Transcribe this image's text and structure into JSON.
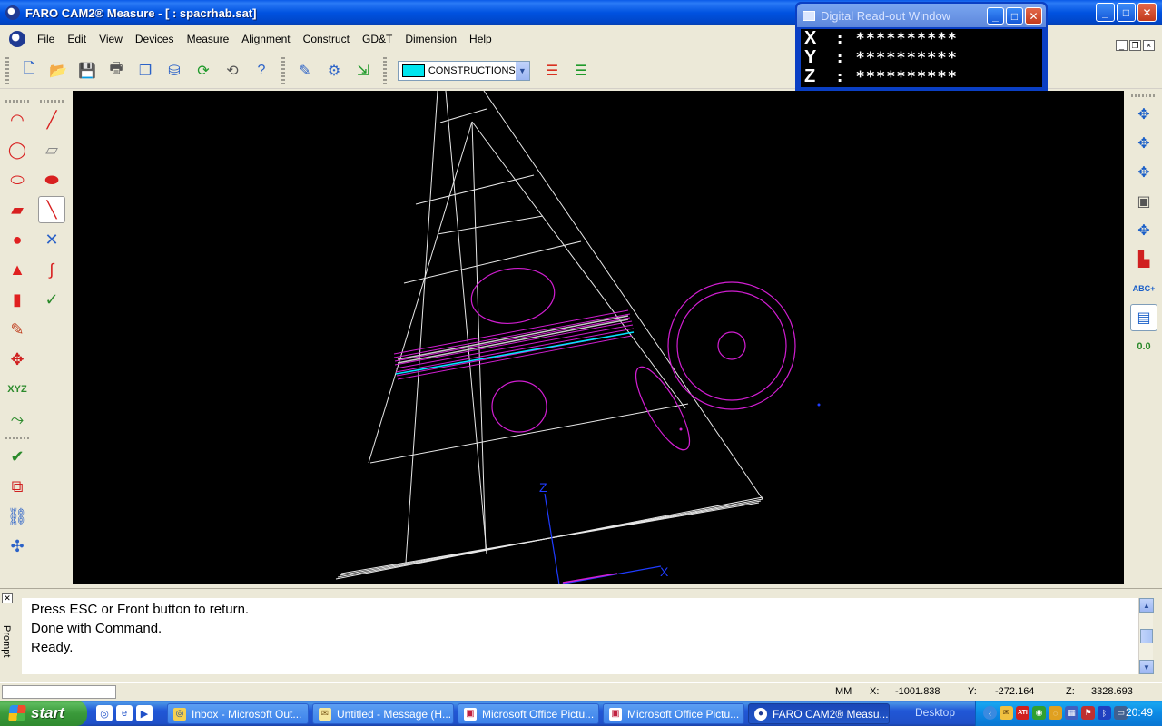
{
  "window": {
    "title": "FARO CAM2® Measure - [ : spacrhab.sat]",
    "controls": {
      "minimize": "_",
      "maximize": "□",
      "close": "✕"
    }
  },
  "menu": {
    "items": [
      {
        "label": "File"
      },
      {
        "label": "Edit"
      },
      {
        "label": "View"
      },
      {
        "label": "Devices"
      },
      {
        "label": "Measure"
      },
      {
        "label": "Alignment"
      },
      {
        "label": "Construct"
      },
      {
        "label": "GD&T"
      },
      {
        "label": "Dimension"
      },
      {
        "label": "Help"
      }
    ]
  },
  "toolbar": {
    "layer_name": "CONSTRUCTIONS",
    "layer_color": "#00e5ee",
    "buttons": [
      "new-file-icon",
      "open-folder-icon",
      "save-icon",
      "print-icon",
      "copy-icon",
      "bucket-icon",
      "rotate-green-icon",
      "rotate-gray-icon",
      "help-icon",
      "edit-document-icon",
      "document-settings-icon",
      "export-document-icon",
      "layers-icon",
      "layers-color-icon"
    ]
  },
  "dro": {
    "title": "Digital Read-out Window",
    "rows": [
      {
        "axis": "X",
        "value": "**********"
      },
      {
        "axis": "Y",
        "value": "**********"
      },
      {
        "axis": "Z",
        "value": "**********"
      }
    ]
  },
  "viewport": {
    "axis_labels": {
      "x": "X",
      "z": "Z"
    },
    "colors": {
      "geometry": "#e8e8e8",
      "feature": "#d21ed2",
      "highlight": "#00e5ff",
      "axis": "#1f3cff"
    }
  },
  "prompt": {
    "label": "Prompt",
    "lines": [
      "Press ESC or Front button to return.",
      "Done with Command.",
      "Ready."
    ]
  },
  "status": {
    "units": "MM",
    "x_label": "X:",
    "x_value": "-1001.838",
    "y_label": "Y:",
    "y_value": "-272.164",
    "z_label": "Z:",
    "z_value": "3328.693"
  },
  "taskbar": {
    "start_label": "start",
    "tasks": [
      {
        "label": "Inbox - Microsoft Out..."
      },
      {
        "label": "Untitled - Message (H..."
      },
      {
        "label": "Microsoft Office Pictu..."
      },
      {
        "label": "Microsoft Office Pictu..."
      },
      {
        "label": "FARO CAM2® Measu..."
      }
    ],
    "desktop_label": "Desktop",
    "tray_text": "ATI",
    "clock": "20:49"
  }
}
